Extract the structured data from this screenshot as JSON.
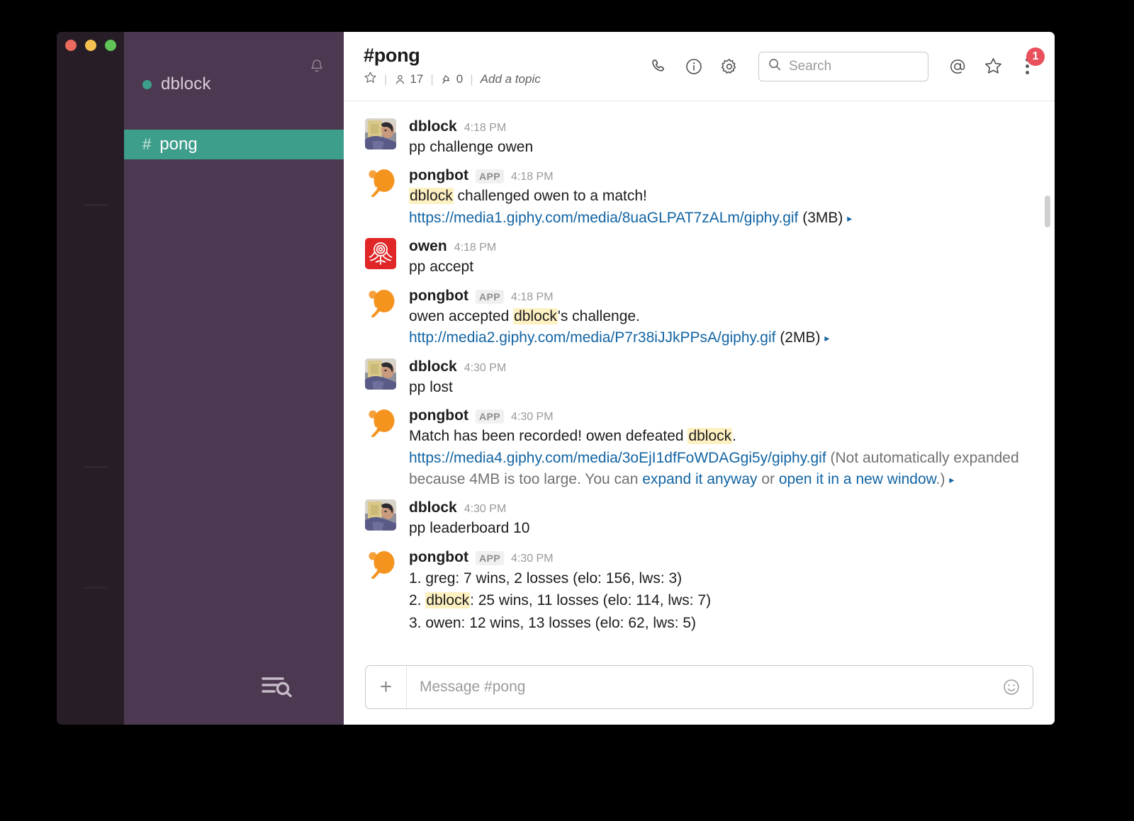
{
  "window": {
    "traffic_lights": [
      "close",
      "minimize",
      "zoom"
    ]
  },
  "sidebar": {
    "workspace_name": "dblock",
    "presence": "active",
    "presence_color": "#3d9e8c",
    "notifications_icon": "bell-icon",
    "browse_icon": "channel-browser-icon",
    "active_channel_color": "#3d9e8c",
    "channels": [
      {
        "prefix": "#",
        "name": "pong",
        "active": true
      }
    ]
  },
  "header": {
    "channel_title": "#pong",
    "star_icon": "star-icon",
    "members_icon": "person-icon",
    "members_count": "17",
    "pin_icon": "pin-icon",
    "pins_count": "0",
    "topic_placeholder": "Add a topic",
    "separator": "|",
    "call_icon": "phone-icon",
    "info_icon": "info-icon",
    "settings_icon": "gear-icon",
    "mentions_icon": "at-icon",
    "starred_icon": "star-icon",
    "more_icon": "kebab-menu-icon",
    "badge_count": "1",
    "badge_color": "#e8505b"
  },
  "search": {
    "placeholder": "Search",
    "value": "",
    "icon": "search-icon"
  },
  "messages": [
    {
      "id": "m1",
      "avatar": "dblock-photo",
      "author": "dblock",
      "is_app": false,
      "time": "4:18 PM",
      "parts": [
        {
          "t": "plain",
          "v": "pp challenge owen"
        }
      ]
    },
    {
      "id": "m2",
      "avatar": "pongbot-paddle",
      "author": "pongbot",
      "is_app": true,
      "app_label": "APP",
      "time": "4:18 PM",
      "parts": [
        {
          "t": "highlight",
          "v": "dblock"
        },
        {
          "t": "plain",
          "v": " challenged owen to a match!"
        },
        {
          "t": "br",
          "v": ""
        },
        {
          "t": "link",
          "v": "https://media1.giphy.com/media/8uaGLPAT7zALm/giphy.gif"
        },
        {
          "t": "plain",
          "v": " (3MB) "
        },
        {
          "t": "caret",
          "v": "▸"
        }
      ]
    },
    {
      "id": "m3",
      "avatar": "owen-rose",
      "author": "owen",
      "is_app": false,
      "time": "4:18 PM",
      "parts": [
        {
          "t": "plain",
          "v": "pp accept"
        }
      ]
    },
    {
      "id": "m4",
      "avatar": "pongbot-paddle",
      "author": "pongbot",
      "is_app": true,
      "app_label": "APP",
      "time": "4:18 PM",
      "parts": [
        {
          "t": "plain",
          "v": "owen accepted "
        },
        {
          "t": "highlight",
          "v": "dblock"
        },
        {
          "t": "plain",
          "v": "'s challenge."
        },
        {
          "t": "br",
          "v": ""
        },
        {
          "t": "link",
          "v": "http://media2.giphy.com/media/P7r38iJJkPPsA/giphy.gif"
        },
        {
          "t": "plain",
          "v": " (2MB) "
        },
        {
          "t": "caret",
          "v": "▸"
        }
      ]
    },
    {
      "id": "m5",
      "avatar": "dblock-photo",
      "author": "dblock",
      "is_app": false,
      "time": "4:30 PM",
      "parts": [
        {
          "t": "plain",
          "v": "pp lost"
        }
      ]
    },
    {
      "id": "m6",
      "avatar": "pongbot-paddle",
      "author": "pongbot",
      "is_app": true,
      "app_label": "APP",
      "time": "4:30 PM",
      "parts": [
        {
          "t": "plain",
          "v": "Match has been recorded! owen defeated "
        },
        {
          "t": "highlight",
          "v": "dblock"
        },
        {
          "t": "plain",
          "v": "."
        },
        {
          "t": "br",
          "v": ""
        },
        {
          "t": "link",
          "v": "https://media4.giphy.com/media/3oEjI1dfFoWDAGgi5y/giphy.gif"
        },
        {
          "t": "muted",
          "v": " (Not automatically expanded because 4MB is too large. You can "
        },
        {
          "t": "link",
          "v": "expand it anyway"
        },
        {
          "t": "muted",
          "v": " or "
        },
        {
          "t": "link",
          "v": "open it in a new window"
        },
        {
          "t": "muted",
          "v": ".) "
        },
        {
          "t": "caret",
          "v": "▸"
        }
      ]
    },
    {
      "id": "m7",
      "avatar": "dblock-photo",
      "author": "dblock",
      "is_app": false,
      "time": "4:30 PM",
      "parts": [
        {
          "t": "plain",
          "v": "pp leaderboard 10"
        }
      ]
    },
    {
      "id": "m8",
      "avatar": "pongbot-paddle",
      "author": "pongbot",
      "is_app": true,
      "app_label": "APP",
      "time": "4:30 PM",
      "leaderboard": [
        {
          "rank": "1.",
          "name": "greg",
          "highlight": false,
          "stats": ": 7 wins, 2 losses (elo: 156, lws: 3)"
        },
        {
          "rank": "2.",
          "name": "dblock",
          "highlight": true,
          "stats": ": 25 wins, 11 losses (elo: 114, lws: 7)"
        },
        {
          "rank": "3.",
          "name": "owen",
          "highlight": false,
          "stats": ": 12 wins, 13 losses (elo: 62, lws: 5)"
        }
      ]
    }
  ],
  "composer": {
    "add_icon": "plus-icon",
    "placeholder": "Message #pong",
    "value": "",
    "emoji_icon": "smiley-icon"
  }
}
